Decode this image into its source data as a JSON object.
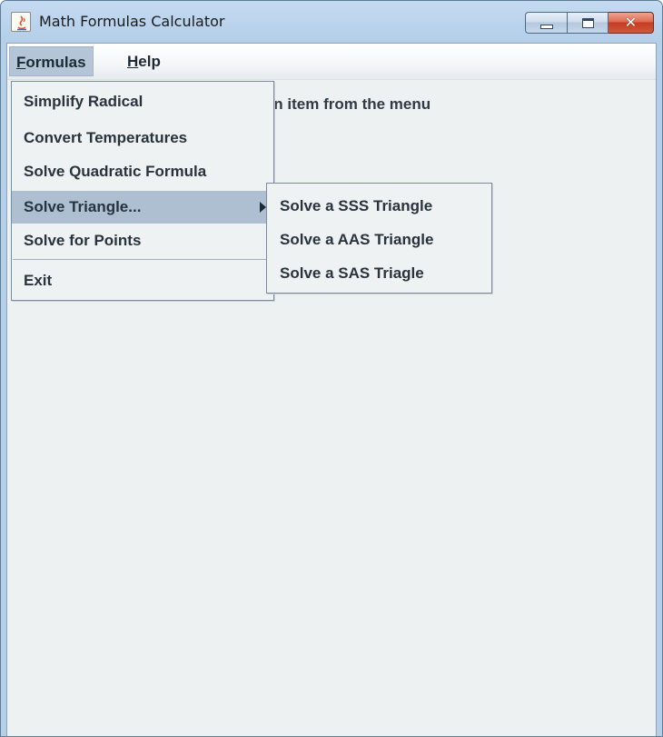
{
  "window": {
    "title": "Math Formulas Calculator",
    "icons": {
      "app": "java-cup-icon",
      "minimize": "minimize-icon",
      "maximize": "maximize-icon",
      "close": "close-icon"
    },
    "close_glyph": "✕"
  },
  "menubar": {
    "formulas": {
      "mnemonic": "F",
      "rest": "ormulas"
    },
    "help": {
      "mnemonic": "H",
      "rest": "elp"
    }
  },
  "status": {
    "text": "ct an item from the menu"
  },
  "formulas_menu": {
    "items": [
      {
        "label": "Simplify Radical"
      },
      {
        "label": "Convert Temperatures"
      },
      {
        "label": "Solve Quadratic Formula"
      },
      {
        "label": "Solve Triangle...",
        "highlighted": true,
        "has_submenu": true
      },
      {
        "label": "Solve for Points"
      },
      {
        "label": "Exit"
      }
    ]
  },
  "triangle_submenu": {
    "items": [
      {
        "label": "Solve a SSS Triangle"
      },
      {
        "label": "Solve a AAS Triangle"
      },
      {
        "label": "Solve a SAS Triagle"
      }
    ]
  },
  "colors": {
    "titlebar": "#b9d2ec",
    "menu_highlight": "#aebfd2",
    "client_bg": "#eef1f1",
    "close_button": "#c43c22"
  }
}
